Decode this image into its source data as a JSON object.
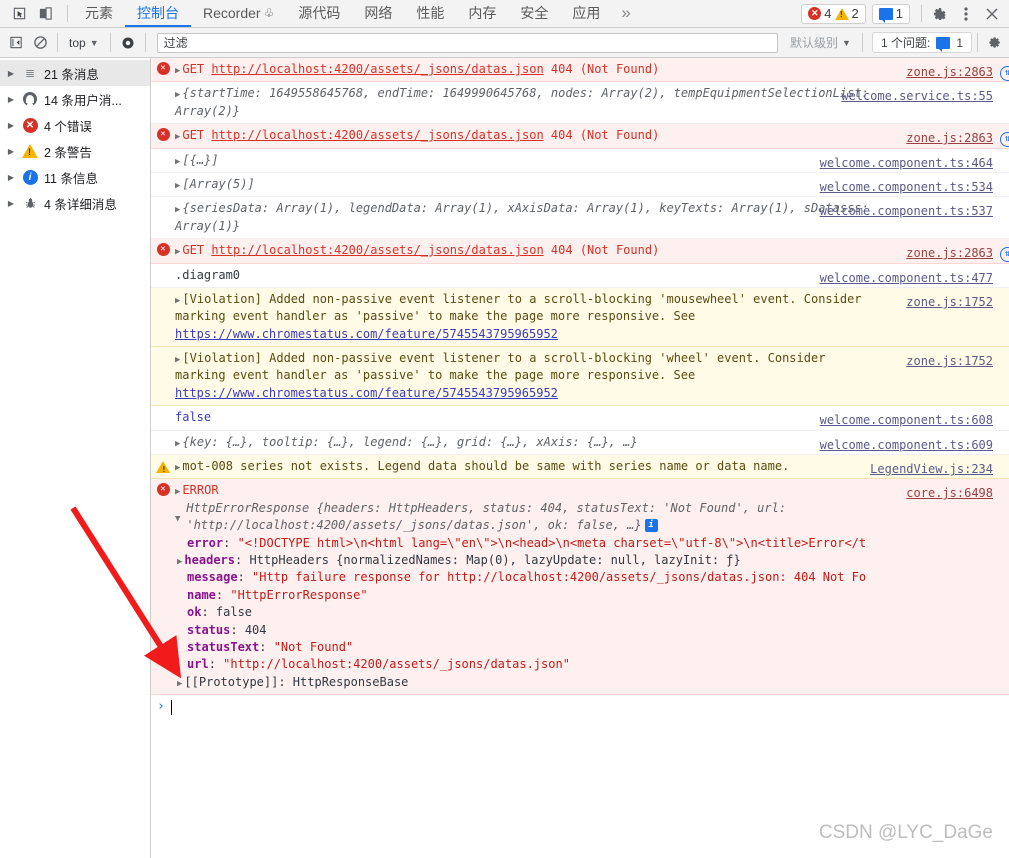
{
  "window": {
    "title": "Chrome DevTools Console"
  },
  "toolbar": {
    "inspect_icon": "inspect-element-icon",
    "device_icon": "device-toolbar-icon",
    "tabs": [
      {
        "label": "元素",
        "name": "elements",
        "active": false
      },
      {
        "label": "控制台",
        "name": "console",
        "active": true
      },
      {
        "label": "Recorder",
        "name": "recorder",
        "active": false,
        "suffix_icon": "flask-icon"
      },
      {
        "label": "源代码",
        "name": "sources",
        "active": false
      },
      {
        "label": "网络",
        "name": "network",
        "active": false
      },
      {
        "label": "性能",
        "name": "performance",
        "active": false
      },
      {
        "label": "内存",
        "name": "memory",
        "active": false
      },
      {
        "label": "安全",
        "name": "security",
        "active": false
      },
      {
        "label": "应用",
        "name": "application",
        "active": false
      }
    ],
    "more_tabs_label": "»",
    "error_count": "4",
    "warning_count": "2",
    "issue_count": "1",
    "settings_icon": "gear-icon",
    "menu_icon": "kebab-menu-icon",
    "close_icon": "close-icon"
  },
  "filterbar": {
    "clear_console_icon": "clear-console-icon",
    "no_entry_icon": "no-entry-icon",
    "context_label": "top",
    "eye_icon": "live-expression-eye-icon",
    "filter_placeholder": "过滤",
    "filter_value": "",
    "level_label": "默认级别",
    "issues_label": "1 个问题:",
    "issues_count": "1",
    "settings_icon": "console-settings-icon"
  },
  "sidebar": {
    "items": [
      {
        "label": "21 条消息",
        "icon": "list-icon",
        "name": "all-messages",
        "selected": true
      },
      {
        "label": "14 条用户消...",
        "icon": "person-icon",
        "name": "user-messages",
        "selected": false
      },
      {
        "label": "4 个错误",
        "icon": "error-icon",
        "name": "errors",
        "selected": false
      },
      {
        "label": "2 条警告",
        "icon": "warning-icon",
        "name": "warnings",
        "selected": false
      },
      {
        "label": "11 条信息",
        "icon": "info-icon",
        "name": "info",
        "selected": false
      },
      {
        "label": "4 条详细消息",
        "icon": "bug-icon",
        "name": "verbose",
        "selected": false
      }
    ]
  },
  "console_rows": [
    {
      "id": "r1",
      "kind": "error",
      "gutter": "error-icon",
      "disclosure": "collapsed",
      "method": "GET",
      "url": "http://localhost:4200/assets/_jsons/datas.json",
      "status": "404 (Not Found)",
      "source": "zone.js:2863",
      "has_network_icon": true
    },
    {
      "id": "r2",
      "kind": "plain",
      "gutter": "none",
      "disclosure": "collapsed",
      "text": "{startTime: 1649558645768, endTime: 1649990645768, nodes: Array(2), tempEquipmentSelectionList: Array(2)}",
      "source": "welcome.service.ts:55"
    },
    {
      "id": "r3",
      "kind": "error",
      "gutter": "error-icon",
      "disclosure": "collapsed",
      "method": "GET",
      "url": "http://localhost:4200/assets/_jsons/datas.json",
      "status": "404 (Not Found)",
      "source": "zone.js:2863",
      "has_network_icon": true
    },
    {
      "id": "r4",
      "kind": "plain",
      "gutter": "none",
      "disclosure": "collapsed",
      "text": "[{…}]",
      "source": "welcome.component.ts:464"
    },
    {
      "id": "r5",
      "kind": "plain",
      "gutter": "none",
      "disclosure": "collapsed",
      "text": "[Array(5)]",
      "source": "welcome.component.ts:534"
    },
    {
      "id": "r6",
      "kind": "plain",
      "gutter": "none",
      "disclosure": "collapsed",
      "text": "{seriesData: Array(1), legendData: Array(1), xAxisData: Array(1), keyTexts: Array(1), sDatasss: Array(1)}",
      "source": "welcome.component.ts:537"
    },
    {
      "id": "r7",
      "kind": "error",
      "gutter": "error-icon",
      "disclosure": "collapsed",
      "method": "GET",
      "url": "http://localhost:4200/assets/_jsons/datas.json",
      "status": "404 (Not Found)",
      "source": "zone.js:2863",
      "has_network_icon": true
    },
    {
      "id": "r8",
      "kind": "plain",
      "gutter": "none",
      "disclosure": "none",
      "text": ".diagram0",
      "source": "welcome.component.ts:477"
    },
    {
      "id": "r9",
      "kind": "warn",
      "gutter": "none",
      "disclosure": "collapsed",
      "text": "[Violation] Added non-passive event listener to a scroll-blocking 'mousewheel' event. Consider marking event handler as 'passive' to make the page more responsive. See ",
      "inline_link": "https://www.chromestatus.com/feature/5745543795965952",
      "source": "zone.js:1752"
    },
    {
      "id": "r10",
      "kind": "warn",
      "gutter": "none",
      "disclosure": "collapsed",
      "text": "[Violation] Added non-passive event listener to a scroll-blocking 'wheel' event. Consider marking event handler as 'passive' to make the page more responsive. See ",
      "inline_link": "https://www.chromestatus.com/feature/5745543795965952",
      "source": "zone.js:1752"
    },
    {
      "id": "r11",
      "kind": "plain",
      "gutter": "none",
      "disclosure": "none",
      "text": "false",
      "source": "welcome.component.ts:608"
    },
    {
      "id": "r12",
      "kind": "plain",
      "gutter": "none",
      "disclosure": "collapsed",
      "text": "{key: {…}, tooltip: {…}, legend: {…}, grid: {…}, xAxis: {…}, …}",
      "source": "welcome.component.ts:609"
    },
    {
      "id": "r13",
      "kind": "warn",
      "gutter": "warning-icon",
      "disclosure": "collapsed",
      "text": "mot-008 series not exists. Legend data should be same with series name or data name.",
      "source": "LegendView.js:234"
    }
  ],
  "error_block": {
    "kind": "error",
    "gutter": "error-icon",
    "label": "ERROR",
    "source": "core.js:6498",
    "header": "HttpErrorResponse {headers: HttpHeaders, status: 404, statusText: 'Not Found', url: 'http://localhost:4200/assets/_jsons/datas.json', ok: false, …}",
    "header_parts": {
      "ctor": "HttpErrorResponse ",
      "status_key": "status: ",
      "status_val": "404",
      "statustext_key": "statusText: ",
      "statustext_val": "'Not Found'",
      "url_key": "url: ",
      "url_val": "'http://localhost:4200/assets/_jsons/datas.json'",
      "ok_key": "ok: ",
      "ok_val": "false"
    },
    "properties": [
      {
        "key": "error",
        "value": "\"<!DOCTYPE html>\\n<html lang=\\\"en\\\">\\n<head>\\n<meta charset=\\\"utf-8\\\">\\n<title>Error</t",
        "type": "string",
        "disclosure": "none"
      },
      {
        "key": "headers",
        "value": "HttpHeaders {normalizedNames: Map(0), lazyUpdate: null, lazyInit: ƒ}",
        "type": "object",
        "disclosure": "collapsed"
      },
      {
        "key": "message",
        "value": "\"Http failure response for http://localhost:4200/assets/_jsons/datas.json: 404 Not Fo",
        "type": "string",
        "disclosure": "none"
      },
      {
        "key": "name",
        "value": "\"HttpErrorResponse\"",
        "type": "string",
        "disclosure": "none"
      },
      {
        "key": "ok",
        "value": "false",
        "type": "plain",
        "disclosure": "none"
      },
      {
        "key": "status",
        "value": "404",
        "type": "number",
        "disclosure": "none"
      },
      {
        "key": "statusText",
        "value": "\"Not Found\"",
        "type": "string",
        "disclosure": "none"
      },
      {
        "key": "url",
        "value": "\"http://localhost:4200/assets/_jsons/datas.json\"",
        "type": "string",
        "disclosure": "none"
      },
      {
        "key": "[[Prototype]]",
        "value": "HttpResponseBase",
        "type": "plain",
        "disclosure": "collapsed"
      }
    ]
  },
  "prompt": {
    "caret": "›",
    "value": ""
  },
  "watermark": "CSDN @LYC_DaGe",
  "annotation": {
    "type": "red-arrow",
    "color": "#f21b1b"
  }
}
